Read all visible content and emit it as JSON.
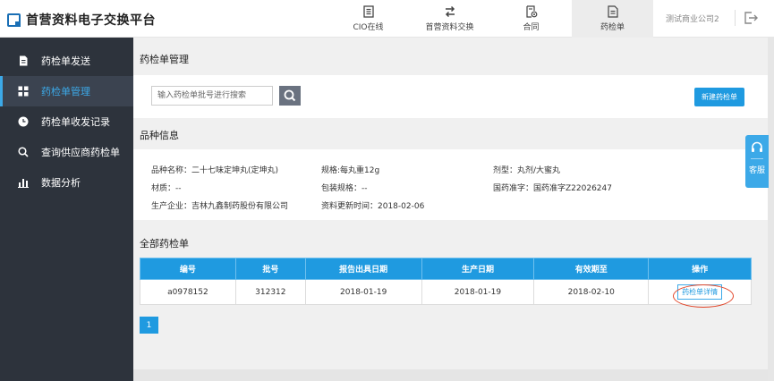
{
  "header": {
    "app_title": "首营资料电子交换平台",
    "nav": [
      {
        "label": "CIO在线",
        "icon": "document-list-icon"
      },
      {
        "label": "首营资料交换",
        "icon": "exchange-arrows-icon"
      },
      {
        "label": "合同",
        "icon": "contract-icon"
      },
      {
        "label": "药检单",
        "icon": "inspection-report-icon"
      }
    ],
    "active_nav": "药检单",
    "company": "测试商业公司2",
    "logout_icon": "logout-icon"
  },
  "sidebar": {
    "items": [
      {
        "label": "药检单发送",
        "icon": "file-icon"
      },
      {
        "label": "药检单管理",
        "icon": "grid-icon"
      },
      {
        "label": "药检单收发记录",
        "icon": "clock-icon"
      },
      {
        "label": "查询供应商药检单",
        "icon": "search-icon"
      },
      {
        "label": "数据分析",
        "icon": "bar-chart-icon"
      }
    ],
    "active": "药检单管理"
  },
  "main": {
    "title": "药检单管理",
    "search": {
      "placeholder": "输入药检单批号进行搜索",
      "value": ""
    },
    "new_button": "新建药检单",
    "product_section_title": "品种信息",
    "product": {
      "name": "品种名称：二十七味定坤丸(定坤丸)",
      "spec": "规格:每丸重12g",
      "dosage_form": "剂型：丸剂/大蜜丸",
      "material": "材质：--",
      "package": "包装规格：--",
      "approval": "国药准字：国药准字Z22026247",
      "manufacturer": "生产企业：吉林九鑫制药股份有限公司",
      "updated": "资料更新时间：2018-02-06"
    },
    "list_section_title": "全部药检单",
    "table": {
      "headers": [
        "编号",
        "批号",
        "报告出具日期",
        "生产日期",
        "有效期至",
        "操作"
      ],
      "rows": [
        {
          "id": "a0978152",
          "batch": "312312",
          "report_date": "2018-01-19",
          "production_date": "2018-01-19",
          "expiry": "2018-02-10",
          "action": "药检单详情"
        }
      ]
    },
    "pagination": {
      "current": "1"
    }
  },
  "service_widget": {
    "label": "客服",
    "icon": "headset-icon"
  },
  "colors": {
    "accent": "#1f9ae0",
    "sidebar_bg": "#2d333c",
    "highlight_circle": "#e2472b"
  }
}
